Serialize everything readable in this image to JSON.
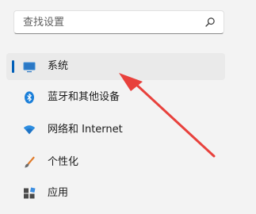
{
  "search": {
    "placeholder": "查找设置"
  },
  "nav": {
    "items": [
      {
        "label": "系统",
        "icon": "display-icon",
        "selected": true
      },
      {
        "label": "蓝牙和其他设备",
        "icon": "bluetooth-icon",
        "selected": false
      },
      {
        "label": "网络和 Internet",
        "icon": "wifi-icon",
        "selected": false
      },
      {
        "label": "个性化",
        "icon": "brush-icon",
        "selected": false
      },
      {
        "label": "应用",
        "icon": "apps-icon",
        "selected": false
      }
    ]
  },
  "colors": {
    "accent": "#005fb8",
    "selected_background": "#eaeaea",
    "arrow": "#e8413c"
  }
}
